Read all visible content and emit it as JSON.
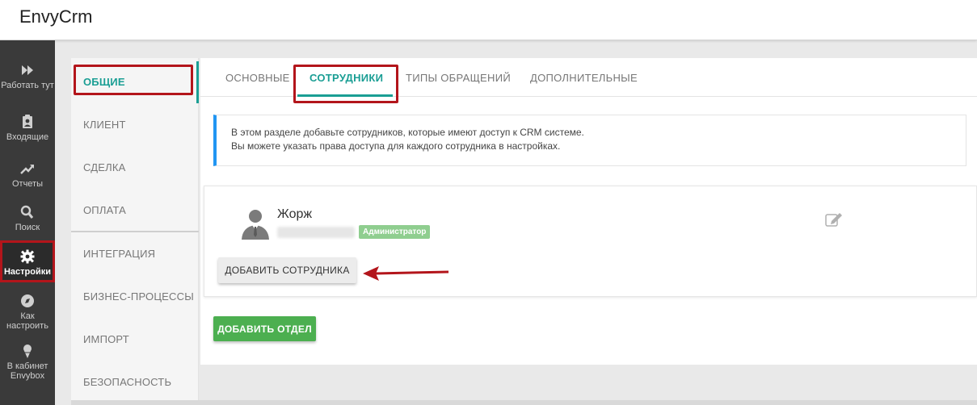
{
  "app": {
    "title": "EnvyCrm"
  },
  "leftnav": {
    "items": [
      {
        "label": "Работать тут",
        "icon": "fast-forward-icon"
      },
      {
        "label": "Входящие",
        "icon": "clipboard-user-icon"
      },
      {
        "label": "Отчеты",
        "icon": "trending-up-icon"
      },
      {
        "label": "Поиск",
        "icon": "search-icon"
      },
      {
        "label": "Настройки",
        "icon": "gear-icon",
        "active": true
      },
      {
        "label": "Как настроить",
        "icon": "compass-icon"
      },
      {
        "label": "В кабинет Envybox",
        "icon": "ice-cream-icon"
      }
    ]
  },
  "subnav": {
    "items": [
      {
        "label": "ОБЩИЕ",
        "active": true
      },
      {
        "label": "КЛИЕНТ"
      },
      {
        "label": "СДЕЛКА"
      },
      {
        "label": "ОПЛАТА"
      },
      {
        "label": "ИНТЕГРАЦИЯ"
      },
      {
        "label": "БИЗНЕС-ПРОЦЕССЫ"
      },
      {
        "label": "ИМПОРТ"
      },
      {
        "label": "БЕЗОПАСНОСТЬ"
      }
    ]
  },
  "tabs": [
    {
      "label": "ОСНОВНЫЕ"
    },
    {
      "label": "СОТРУДНИКИ",
      "active": true
    },
    {
      "label": "ТИПЫ ОБРАЩЕНИЙ"
    },
    {
      "label": "ДОПОЛНИТЕЛЬНЫЕ"
    }
  ],
  "info": {
    "line1": "В этом разделе добавьте сотрудников, которые имеют доступ к CRM системе.",
    "line2": "Вы можете указать права доступа для каждого сотрудника в настройках."
  },
  "employee": {
    "name": "Жорж",
    "role": "Администратор"
  },
  "buttons": {
    "add_employee": "ДОБАВИТЬ СОТРУДНИКА",
    "add_department": "ДОБАВИТЬ ОТДЕЛ"
  },
  "colors": {
    "accent": "#1a9e94",
    "highlight": "#b3151b",
    "sidebar": "#3a3a3a",
    "add_department": "#4caf50",
    "role_badge": "#8fce8f",
    "info_border": "#2196f3"
  }
}
